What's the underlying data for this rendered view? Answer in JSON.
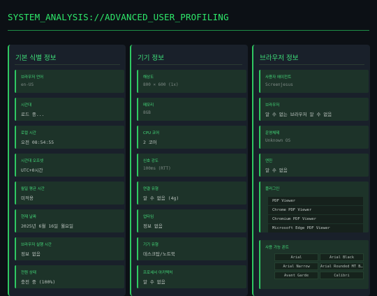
{
  "header": {
    "title": "SYSTEM_ANALYSIS://ADVANCED_USER_PROFILING"
  },
  "panels": [
    {
      "title": "기본 식별 정보",
      "cards": [
        {
          "label": "브라우저 언어",
          "value": "en-US"
        },
        {
          "label": "시간대",
          "value": "로드 중..."
        },
        {
          "label": "로컬 시간",
          "value": "오전 08:54:55"
        },
        {
          "label": "시간대 오프셋",
          "value": "UTC+0시간"
        },
        {
          "label": "월일 평균 시간",
          "value": "미적용"
        },
        {
          "label": "현재 날짜",
          "value": "2025년 6월 16일 월요일"
        },
        {
          "label": "브라우저 실행 시간",
          "value": "정보 없음"
        },
        {
          "label": "전원 상태",
          "value": "충전 중 (100%)"
        }
      ]
    },
    {
      "title": "기기 정보",
      "cards": [
        {
          "label": "해상도",
          "value": "800 × 600 (1x)"
        },
        {
          "label": "메모리",
          "value": "8GB"
        },
        {
          "label": "CPU 코어",
          "value": "2 코어"
        },
        {
          "label": "신호 강도",
          "value": "100ms (RTT)"
        },
        {
          "label": "연결 유형",
          "value": "알 수 없음 (4g)"
        },
        {
          "label": "업타임",
          "value": "정보 없음"
        },
        {
          "label": "기기 유형",
          "value": "데스크탑/노트북"
        },
        {
          "label": "프로세서 아키텍처",
          "value": "알 수 없음"
        }
      ]
    },
    {
      "title": "브라우저 정보",
      "cards": [
        {
          "label": "사용자 에이전트",
          "value": "Screenjesus"
        },
        {
          "label": "브라우저",
          "value": "알 수 없는 브라우저 알 수 없음"
        },
        {
          "label": "운영체제",
          "value": "Unknown OS"
        },
        {
          "label": "엔진",
          "value": "알 수 없음"
        }
      ],
      "plugins": {
        "label": "플러그인",
        "items": [
          "PDF Viewer",
          "Chrome PDF Viewer",
          "Chromium PDF Viewer",
          "Microsoft Edge PDF Viewer"
        ]
      },
      "fonts": {
        "label": "사용 가능 폰트",
        "items": [
          "Arial",
          "Arial Black",
          "Arial Narrow",
          "Arial Rounded MT Bold",
          "Avant Garde",
          "Calibri"
        ]
      }
    }
  ],
  "colors": {
    "accent": "#2ee86a",
    "panel_bg": "#19202a",
    "card_bg": "#1d3329",
    "page_bg": "#0c1015"
  }
}
